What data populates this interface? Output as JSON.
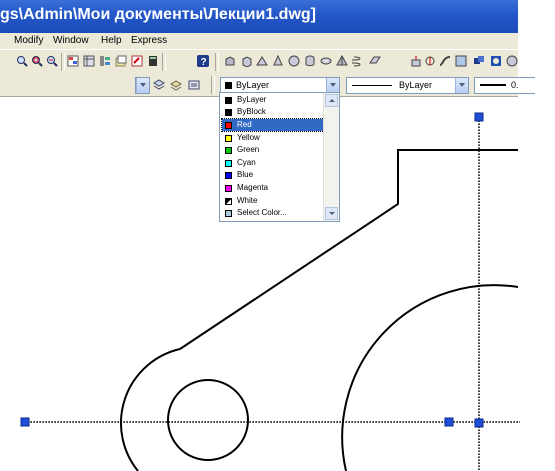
{
  "window": {
    "title": "gs\\Admin\\Мои документы\\Лекции1.dwg]"
  },
  "menu": [
    "Modify",
    "Window",
    "Help",
    "Express"
  ],
  "properties": {
    "color_value": "ByLayer",
    "linetype_value": "ByLayer",
    "lineweight_value": "0."
  },
  "color_dropdown": {
    "items": [
      {
        "label": "ByLayer",
        "color": "#000000"
      },
      {
        "label": "ByBlock",
        "color": "#000000"
      },
      {
        "label": "Red",
        "color": "#ff0000",
        "selected": true
      },
      {
        "label": "Yellow",
        "color": "#ffff00"
      },
      {
        "label": "Green",
        "color": "#00cc00"
      },
      {
        "label": "Cyan",
        "color": "#00ffff"
      },
      {
        "label": "Blue",
        "color": "#0000ff"
      },
      {
        "label": "Magenta",
        "color": "#ff00ff"
      },
      {
        "label": "White",
        "color": "#ffffff"
      },
      {
        "label": "Select Color...",
        "color": "#aaccdd"
      }
    ]
  },
  "colors": {
    "grip": "#1f4ed8",
    "title_bar": "#2457c8"
  }
}
